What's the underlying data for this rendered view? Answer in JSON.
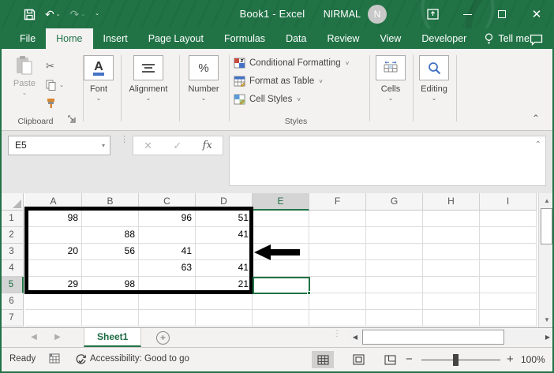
{
  "window": {
    "title": "Book1  -  Excel",
    "user_name": "NIRMAL",
    "avatar_initial": "N"
  },
  "ribbon_tabs": [
    {
      "label": "File"
    },
    {
      "label": "Home"
    },
    {
      "label": "Insert"
    },
    {
      "label": "Page Layout"
    },
    {
      "label": "Formulas"
    },
    {
      "label": "Data"
    },
    {
      "label": "Review"
    },
    {
      "label": "View"
    },
    {
      "label": "Developer"
    }
  ],
  "tell_me_label": "Tell me",
  "ribbon": {
    "clipboard": {
      "paste_label": "Paste",
      "group_label": "Clipboard"
    },
    "font_group": {
      "label": "Font"
    },
    "alignment_group": {
      "label": "Alignment"
    },
    "number_group": {
      "label": "Number",
      "icon_text": "%"
    },
    "styles": {
      "items": [
        "Conditional Formatting",
        "Format as Table",
        "Cell Styles"
      ],
      "group_label": "Styles"
    },
    "cells_group": {
      "label": "Cells"
    },
    "editing_group": {
      "label": "Editing"
    }
  },
  "formula_bar": {
    "name_box": "E5",
    "fx_label": "fx",
    "formula_value": ""
  },
  "grid": {
    "columns": [
      "A",
      "B",
      "C",
      "D",
      "E",
      "F",
      "G",
      "H",
      "I"
    ],
    "rows": [
      "1",
      "2",
      "3",
      "4",
      "5",
      "6",
      "7"
    ],
    "selected_column": "E",
    "selected_row": "5",
    "active_cell": "E5",
    "cell_values": {
      "A1": "98",
      "C1": "96",
      "D1": "51",
      "B2": "88",
      "D2": "41",
      "A3": "20",
      "B3": "56",
      "C3": "41",
      "C4": "63",
      "D4": "41",
      "A5": "29",
      "B5": "98",
      "D5": "21"
    },
    "bordered_range": "A1:D5",
    "annotation_arrow": {
      "direction": "left",
      "points_at_row": "3"
    }
  },
  "sheet_tabs": {
    "active_tab": "Sheet1"
  },
  "status_bar": {
    "mode": "Ready",
    "accessibility": "Accessibility: Good to go",
    "zoom_level": "100%"
  },
  "colors": {
    "excel_green": "#217346",
    "selection_border": "#217346",
    "range_annotation": "#000000"
  }
}
